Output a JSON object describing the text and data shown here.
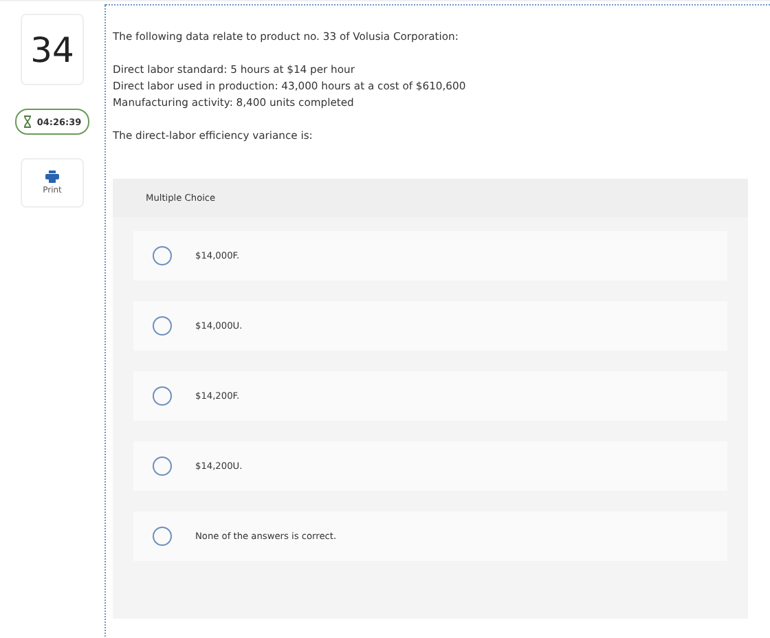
{
  "question_number": "34",
  "timer": "04:26:39",
  "print_label": "Print",
  "question": {
    "intro": "The following data relate to product no. 33 of Volusia Corporation:",
    "facts": [
      "Direct labor standard: 5 hours at $14 per hour",
      "Direct labor used in production: 43,000 hours at a cost of $610,600",
      "Manufacturing activity: 8,400 units completed"
    ],
    "prompt": "The direct-labor efficiency variance is:"
  },
  "answer_panel": {
    "title": "Multiple Choice",
    "options": [
      {
        "label": "$14,000F.",
        "selected": false
      },
      {
        "label": "$14,000U.",
        "selected": false
      },
      {
        "label": "$14,200F.",
        "selected": false
      },
      {
        "label": "$14,200U.",
        "selected": false
      },
      {
        "label": "None of the answers is correct.",
        "selected": false
      }
    ]
  }
}
